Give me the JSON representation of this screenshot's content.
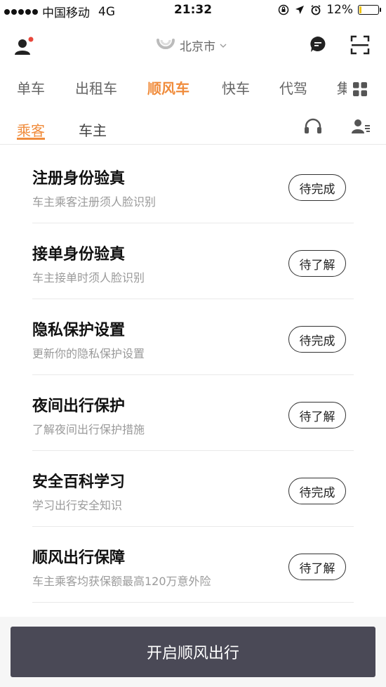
{
  "status_bar": {
    "carrier": "中国移动",
    "network": "4G",
    "time": "21:32",
    "battery": "12%",
    "battery_level": 0.12
  },
  "header": {
    "city": "北京市"
  },
  "services": [
    "单车",
    "出租车",
    "顺风车",
    "快车",
    "代驾",
    "集"
  ],
  "active_service": "顺风车",
  "subtabs": [
    "乘客",
    "车主"
  ],
  "active_subtab": "乘客",
  "items": [
    {
      "title": "注册身份验真",
      "subtitle": "车主乘客注册须人脸识别",
      "button": "待完成"
    },
    {
      "title": "接单身份验真",
      "subtitle": "车主接单时须人脸识别",
      "button": "待了解"
    },
    {
      "title": "隐私保护设置",
      "subtitle": "更新你的隐私保护设置",
      "button": "待完成"
    },
    {
      "title": "夜间出行保护",
      "subtitle": "了解夜间出行保护措施",
      "button": "待了解"
    },
    {
      "title": "安全百科学习",
      "subtitle": "学习出行安全知识",
      "button": "待完成"
    },
    {
      "title": "顺风出行保障",
      "subtitle": "车主乘客均获保额最高120万意外险",
      "button": "待了解"
    }
  ],
  "cta": "开启顺风出行",
  "colors": {
    "accent": "#f08c3c",
    "cta_bg": "#4a4956",
    "notification_dot": "#e8473b"
  }
}
